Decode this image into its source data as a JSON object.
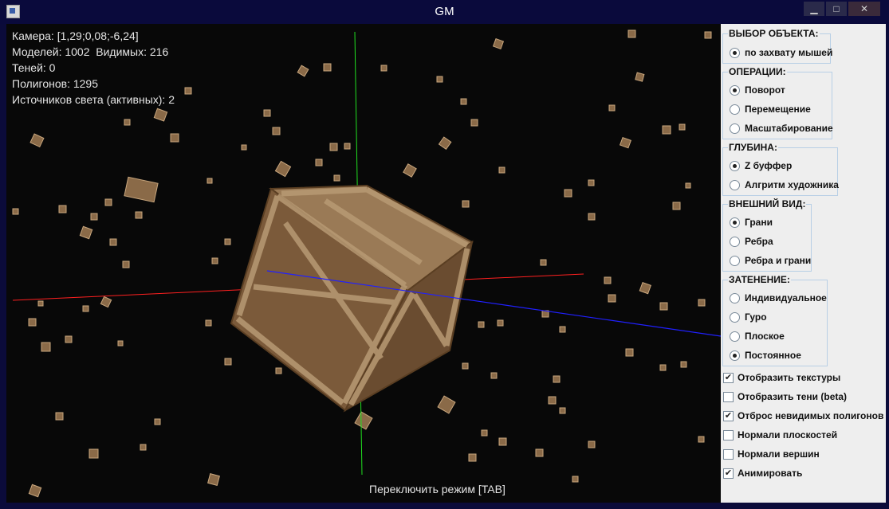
{
  "window": {
    "title": "GM",
    "minimize": "▁",
    "maximize": "□",
    "close": "✕"
  },
  "hud": {
    "camera": "Камера: [1,29;0,08;-6,24]",
    "models": "Моделей: 1002  Видимых: 216",
    "shadows": "Теней: 0",
    "polygons": "Полигонов: 1295",
    "lights": "Источников света (активных): 2",
    "hint": "Переключить режим [TAB]"
  },
  "panel": {
    "selection": {
      "title": "ВЫБОР ОБЪЕКТА:",
      "options": [
        {
          "label": "по захвату мышей",
          "selected": true
        }
      ]
    },
    "operations": {
      "title": "ОПЕРАЦИИ:",
      "options": [
        {
          "label": "Поворот",
          "selected": true
        },
        {
          "label": "Перемещение",
          "selected": false
        },
        {
          "label": "Масштабирование",
          "selected": false
        }
      ]
    },
    "depth": {
      "title": "ГЛУБИНА:",
      "options": [
        {
          "label": "Z буффер",
          "selected": true
        },
        {
          "label": "Алгритм художника",
          "selected": false
        }
      ]
    },
    "appearance": {
      "title": "ВНЕШНИЙ ВИД:",
      "options": [
        {
          "label": "Грани",
          "selected": true
        },
        {
          "label": "Ребра",
          "selected": false
        },
        {
          "label": "Ребра и грани",
          "selected": false
        }
      ]
    },
    "shading": {
      "title": "ЗАТЕНЕНИЕ:",
      "options": [
        {
          "label": "Индивидуальное",
          "selected": false
        },
        {
          "label": "Гуро",
          "selected": false
        },
        {
          "label": "Плоское",
          "selected": false
        },
        {
          "label": "Постоянное",
          "selected": true
        }
      ]
    },
    "checkboxes": [
      {
        "label": "Отобразить текстуры",
        "checked": true
      },
      {
        "label": "Отобразить тени (beta)",
        "checked": false
      },
      {
        "label": "Отброс невидимых полигонов",
        "checked": true
      },
      {
        "label": "Нормали плоскостей",
        "checked": false
      },
      {
        "label": "Нормали вершин",
        "checked": false
      },
      {
        "label": "Анимировать",
        "checked": true
      }
    ]
  },
  "colors": {
    "x_axis": "#ff2020",
    "y_axis": "#20e020",
    "z_axis": "#2020ff",
    "crate": "#8a6a48"
  }
}
